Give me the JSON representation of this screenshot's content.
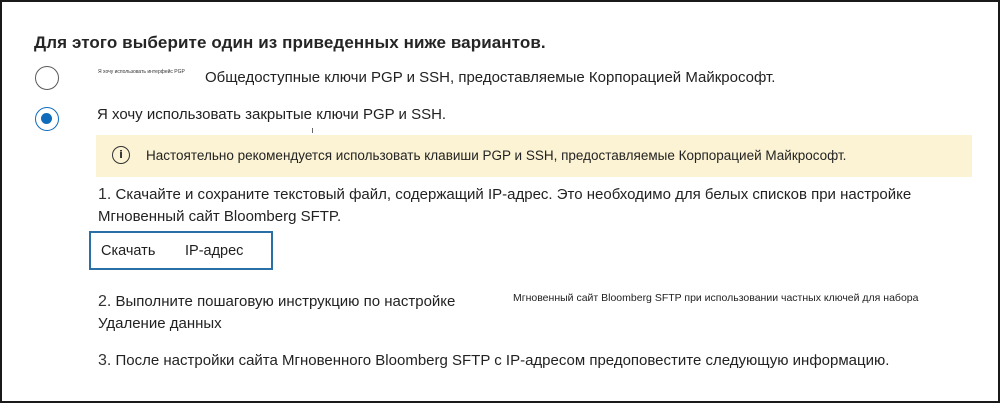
{
  "heading": "Для этого выберите один из приведенных ниже вариантов.",
  "options": [
    {
      "note": "Я хочу использовать интерфейс PGP",
      "label": "Общедоступные ключи PGP и SSH, предоставляемые Корпорацией Майкрософт.",
      "selected": false
    },
    {
      "label": "Я хочу использовать закрытые ключи PGP и SSH.",
      "selected": true
    }
  ],
  "banner": {
    "icon": "info-icon",
    "text": "Настоятельно рекомендуется использовать клавиши PGP и SSH, предоставляемые Корпорацией Майкрософт.",
    "background": "#fbf3d3"
  },
  "steps": {
    "step1": {
      "number": "1.",
      "text": "Скачайте и сохраните текстовый файл, содержащий IP-адрес. Это необходимо для белых списков при настройке Мгновенный сайт Bloomberg SFTP."
    },
    "download": {
      "label_a": "Скачать",
      "label_b": "IP-адрес"
    },
    "step2": {
      "number": "2.",
      "text": "Выполните пошаговую инструкцию по настройке Удаление данных",
      "side_text": "Мгновенный сайт Bloomberg SFTP при использовании частных ключей для набора"
    },
    "step3": {
      "number": "3.",
      "text": "После настройки сайта Мгновенного Bloomberg SFTP с IP-адресом предоповестите следующую информацию."
    }
  },
  "colors": {
    "accent": "#0f6cbd",
    "download_border": "#2a6fa6"
  }
}
